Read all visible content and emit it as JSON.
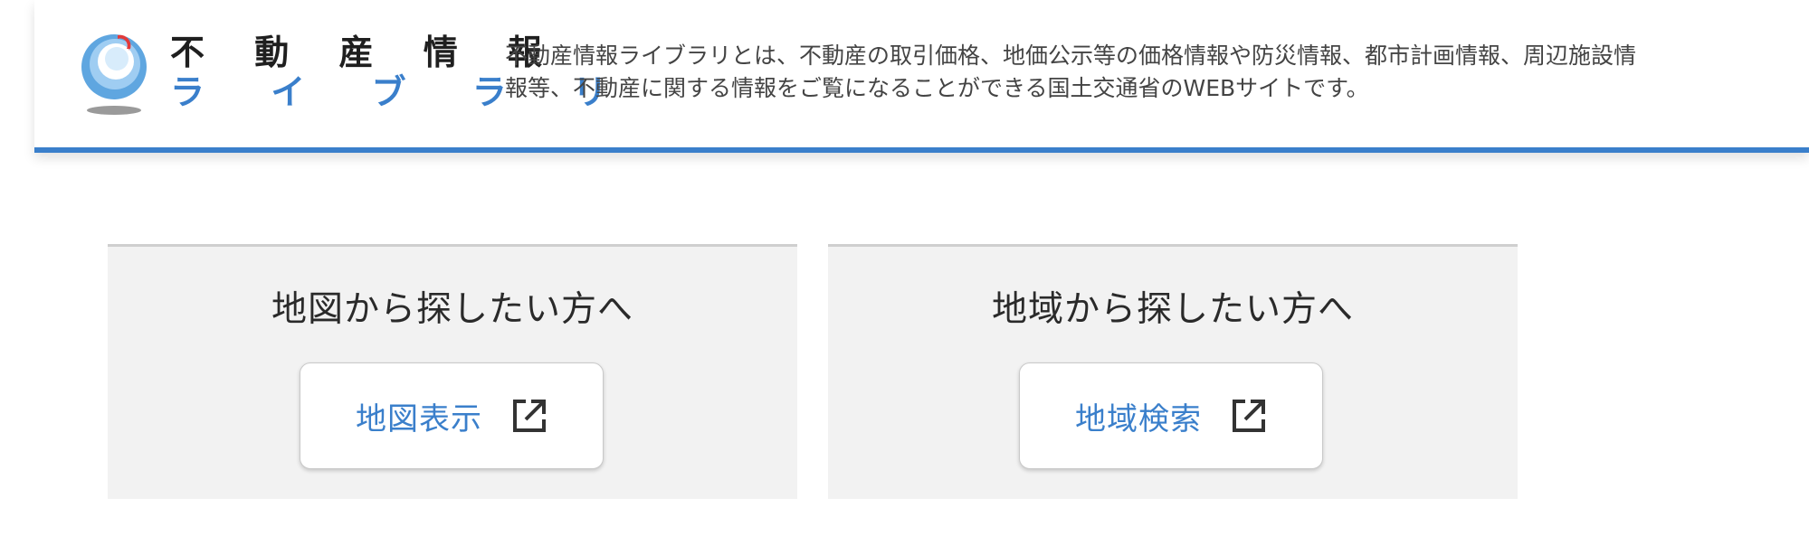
{
  "header": {
    "logo": {
      "line1": "不 動 産 情 報",
      "line2": "ラ イ ブ ラ リ"
    },
    "description_lines": [
      "不動産情報ライブラリとは、不動産の取引価格、地価公示等の価格情報や防災情報、都市計画情報、周辺施設情",
      "報等、不動産に関する情報をご覧になることができる国土交通省のWEBサイトです。"
    ]
  },
  "panels": [
    {
      "title": "地図から探したい方へ",
      "button_label": "地図表示",
      "icon": "external-link-icon"
    },
    {
      "title": "地域から探したい方へ",
      "button_label": "地域検索",
      "icon": "external-link-icon"
    }
  ],
  "colors": {
    "accent": "#3a7fcb",
    "panel_bg": "#f2f2f2",
    "text": "#2a2a2a"
  }
}
